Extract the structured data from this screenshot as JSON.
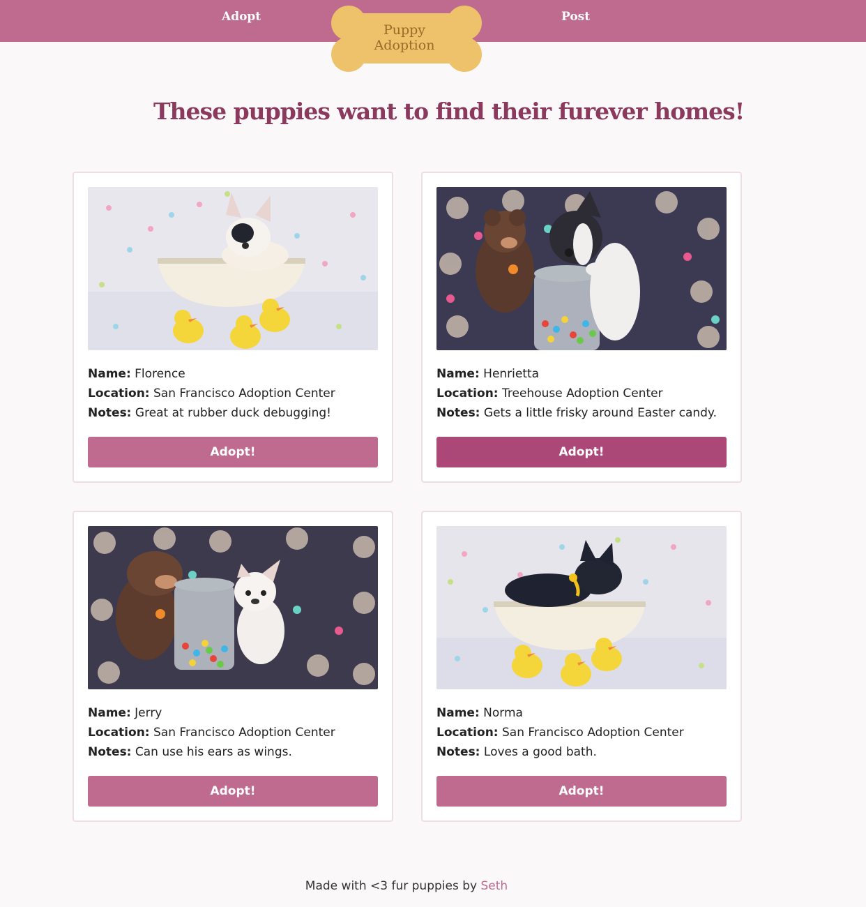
{
  "nav": {
    "adopt_label": "Adopt",
    "post_label": "Post"
  },
  "logo": {
    "line1": "Puppy",
    "line2": "Adoption"
  },
  "headline": "These puppies want to find their furever homes!",
  "labels": {
    "name": "Name:",
    "location": "Location:",
    "notes": "Notes:"
  },
  "puppies": [
    {
      "name": "Florence",
      "location": "San Francisco Adoption Center",
      "notes": "Great at rubber duck debugging!",
      "button": "Adopt!"
    },
    {
      "name": "Henrietta",
      "location": "Treehouse Adoption Center",
      "notes": "Gets a little frisky around Easter candy.",
      "button": "Adopt!"
    },
    {
      "name": "Jerry",
      "location": "San Francisco Adoption Center",
      "notes": "Can use his ears as wings.",
      "button": "Adopt!"
    },
    {
      "name": "Norma",
      "location": "San Francisco Adoption Center",
      "notes": "Loves a good bath.",
      "button": "Adopt!"
    }
  ],
  "footer": {
    "text": "Made with <3 fur puppies by",
    "author": "Seth"
  },
  "colors": {
    "navbar": "#bf6a8f",
    "button": "#bf6a8f",
    "button_hover": "#ac4877",
    "headline": "#8b3a5e",
    "logo_bone": "#edc26a"
  }
}
